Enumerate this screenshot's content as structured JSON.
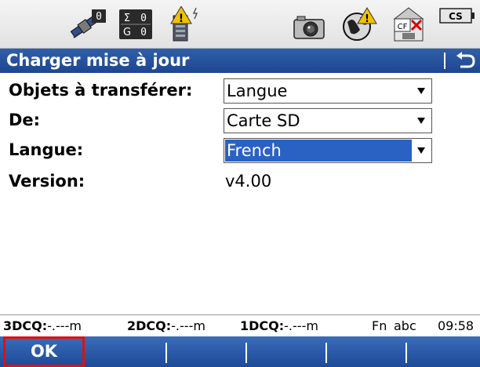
{
  "statusbar": {
    "icons": [
      "satellite-icon",
      "position-quality-icon",
      "battery-warning-icon",
      "camera-icon",
      "globe-warning-icon",
      "cf-card-icon",
      "cs-device-icon"
    ],
    "satellite_count": "0",
    "sigma_label": "Σ",
    "sigma_value": "0",
    "g_label": "G",
    "g_value": "0",
    "cf_label": "CF",
    "cs_label": "CS"
  },
  "title": {
    "text": "Charger mise à jour"
  },
  "form": {
    "fields": [
      {
        "label": "Objets à transférer:",
        "value": "Langue",
        "type": "dropdown"
      },
      {
        "label": "De:",
        "value": "Carte SD",
        "type": "dropdown"
      },
      {
        "label": "Langue:",
        "value": "French",
        "type": "dropdown",
        "selected": true
      },
      {
        "label": "Version:",
        "value": "v4.00",
        "type": "text"
      }
    ]
  },
  "infobar": {
    "dcq3_label": "3DCQ:",
    "dcq3_value": "-.---m",
    "dcq2_label": "2DCQ:",
    "dcq2_value": "-.---m",
    "dcq1_label": "1DCQ:",
    "dcq1_value": "-.---m",
    "fn": "Fn",
    "mode": "abc",
    "time": "09:58"
  },
  "softkeys": {
    "ok_label": "OK"
  },
  "colors": {
    "title_bar": "#1e4690",
    "selection": "#2a62c4",
    "softkey_highlight": "#e01010"
  }
}
